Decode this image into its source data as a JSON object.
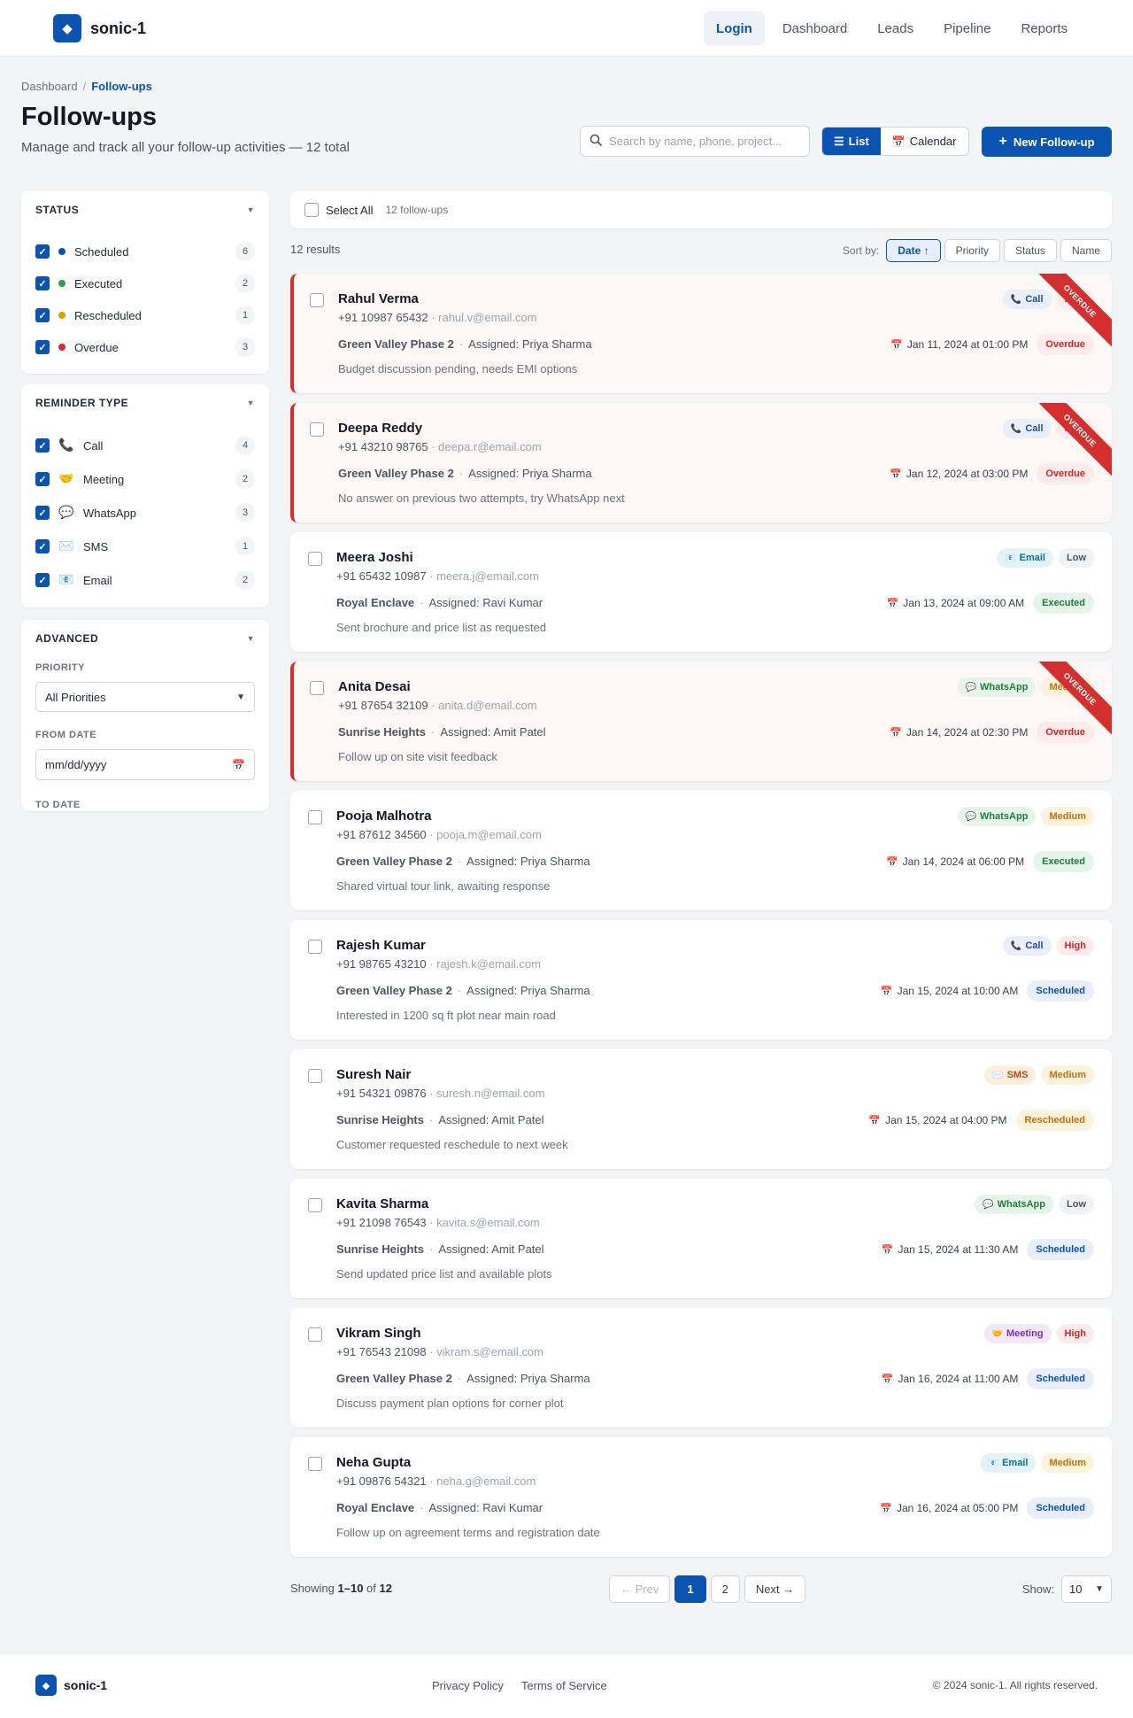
{
  "app": {
    "name": "sonic-1",
    "logo_glyph": "◆"
  },
  "nav": {
    "items": [
      "Login",
      "Dashboard",
      "Leads",
      "Pipeline",
      "Reports"
    ],
    "active": "Login"
  },
  "breadcrumb": {
    "parent": "Dashboard",
    "separator": "/",
    "current": "Follow-ups"
  },
  "page": {
    "title": "Follow-ups",
    "subtitle": "Manage and track all your follow-up activities — 12 total"
  },
  "search": {
    "placeholder": "Search by name, phone, project...",
    "value": ""
  },
  "view_toggle": {
    "list_label": "List",
    "calendar_label": "Calendar",
    "active": "List"
  },
  "new_button": {
    "label": "New Follow-up"
  },
  "filters": {
    "status": {
      "title": "STATUS",
      "items": [
        {
          "label": "Scheduled",
          "count": "6",
          "color": "#0b53b0",
          "checked": true
        },
        {
          "label": "Executed",
          "count": "2",
          "color": "#2e9d4c",
          "checked": true
        },
        {
          "label": "Rescheduled",
          "count": "1",
          "color": "#e0a000",
          "checked": true
        },
        {
          "label": "Overdue",
          "count": "3",
          "color": "#d32f2f",
          "checked": true
        }
      ]
    },
    "reminder_type": {
      "title": "REMINDER TYPE",
      "items": [
        {
          "label": "Call",
          "count": "4",
          "icon": "📞",
          "checked": true
        },
        {
          "label": "Meeting",
          "count": "2",
          "icon": "🤝",
          "checked": true
        },
        {
          "label": "WhatsApp",
          "count": "3",
          "icon": "💬",
          "checked": true
        },
        {
          "label": "SMS",
          "count": "1",
          "icon": "✉️",
          "checked": true
        },
        {
          "label": "Email",
          "count": "2",
          "icon": "📧",
          "checked": true
        }
      ]
    },
    "advanced": {
      "title": "ADVANCED",
      "priority_label": "PRIORITY",
      "priority_value": "All Priorities",
      "from_label": "FROM DATE",
      "from_placeholder": "mm/dd/yyyy",
      "to_label": "TO DATE"
    }
  },
  "selection": {
    "select_all_label": "Select All",
    "count_label": "12 follow-ups"
  },
  "results_label": "12 results",
  "sort": {
    "label": "Sort by:",
    "options": [
      "Date ↑",
      "Priority",
      "Status",
      "Name"
    ],
    "active": "Date ↑"
  },
  "followups": [
    {
      "name": "Rahul Verma",
      "phone": "+91 10987 65432",
      "email": "rahul.v@email.com",
      "project": "Green Valley Phase 2",
      "assigned": "Assigned: Priya Sharma",
      "note": "Budget discussion pending, needs EMI options",
      "datetime": "Jan 11, 2024 at 01:00 PM",
      "channel": "Call",
      "channel_icon": "📞",
      "channel_class": "call",
      "priority": "High",
      "priority_class": "high",
      "status": "Overdue",
      "status_class": "overdue",
      "ribbon": "OVERDUE"
    },
    {
      "name": "Deepa Reddy",
      "phone": "+91 43210 98765",
      "email": "deepa.r@email.com",
      "project": "Green Valley Phase 2",
      "assigned": "Assigned: Priya Sharma",
      "note": "No answer on previous two attempts, try WhatsApp next",
      "datetime": "Jan 12, 2024 at 03:00 PM",
      "channel": "Call",
      "channel_icon": "📞",
      "channel_class": "call",
      "priority": "High",
      "priority_class": "high",
      "status": "Overdue",
      "status_class": "overdue",
      "ribbon": "OVERDUE"
    },
    {
      "name": "Meera Joshi",
      "phone": "+91 65432 10987",
      "email": "meera.j@email.com",
      "project": "Royal Enclave",
      "assigned": "Assigned: Ravi Kumar",
      "note": "Sent brochure and price list as requested",
      "datetime": "Jan 13, 2024 at 09:00 AM",
      "channel": "Email",
      "channel_icon": "📧",
      "channel_class": "email",
      "priority": "Low",
      "priority_class": "low",
      "status": "Executed",
      "status_class": "executed",
      "ribbon": ""
    },
    {
      "name": "Anita Desai",
      "phone": "+91 87654 32109",
      "email": "anita.d@email.com",
      "project": "Sunrise Heights",
      "assigned": "Assigned: Amit Patel",
      "note": "Follow up on site visit feedback",
      "datetime": "Jan 14, 2024 at 02:30 PM",
      "channel": "WhatsApp",
      "channel_icon": "💬",
      "channel_class": "whatsapp",
      "priority": "Medium",
      "priority_class": "medium",
      "status": "Overdue",
      "status_class": "overdue",
      "ribbon": "OVERDUE"
    },
    {
      "name": "Pooja Malhotra",
      "phone": "+91 87612 34560",
      "email": "pooja.m@email.com",
      "project": "Green Valley Phase 2",
      "assigned": "Assigned: Priya Sharma",
      "note": "Shared virtual tour link, awaiting response",
      "datetime": "Jan 14, 2024 at 06:00 PM",
      "channel": "WhatsApp",
      "channel_icon": "💬",
      "channel_class": "whatsapp",
      "priority": "Medium",
      "priority_class": "medium",
      "status": "Executed",
      "status_class": "executed",
      "ribbon": ""
    },
    {
      "name": "Rajesh Kumar",
      "phone": "+91 98765 43210",
      "email": "rajesh.k@email.com",
      "project": "Green Valley Phase 2",
      "assigned": "Assigned: Priya Sharma",
      "note": "Interested in 1200 sq ft plot near main road",
      "datetime": "Jan 15, 2024 at 10:00 AM",
      "channel": "Call",
      "channel_icon": "📞",
      "channel_class": "call",
      "priority": "High",
      "priority_class": "high",
      "status": "Scheduled",
      "status_class": "scheduled",
      "ribbon": ""
    },
    {
      "name": "Suresh Nair",
      "phone": "+91 54321 09876",
      "email": "suresh.n@email.com",
      "project": "Sunrise Heights",
      "assigned": "Assigned: Amit Patel",
      "note": "Customer requested reschedule to next week",
      "datetime": "Jan 15, 2024 at 04:00 PM",
      "channel": "SMS",
      "channel_icon": "✉️",
      "channel_class": "sms",
      "priority": "Medium",
      "priority_class": "medium",
      "status": "Rescheduled",
      "status_class": "rescheduled",
      "ribbon": ""
    },
    {
      "name": "Kavita Sharma",
      "phone": "+91 21098 76543",
      "email": "kavita.s@email.com",
      "project": "Sunrise Heights",
      "assigned": "Assigned: Amit Patel",
      "note": "Send updated price list and available plots",
      "datetime": "Jan 15, 2024 at 11:30 AM",
      "channel": "WhatsApp",
      "channel_icon": "💬",
      "channel_class": "whatsapp",
      "priority": "Low",
      "priority_class": "low",
      "status": "Scheduled",
      "status_class": "scheduled",
      "ribbon": ""
    },
    {
      "name": "Vikram Singh",
      "phone": "+91 76543 21098",
      "email": "vikram.s@email.com",
      "project": "Green Valley Phase 2",
      "assigned": "Assigned: Priya Sharma",
      "note": "Discuss payment plan options for corner plot",
      "datetime": "Jan 16, 2024 at 11:00 AM",
      "channel": "Meeting",
      "channel_icon": "🤝",
      "channel_class": "meeting",
      "priority": "High",
      "priority_class": "high",
      "status": "Scheduled",
      "status_class": "scheduled",
      "ribbon": ""
    },
    {
      "name": "Neha Gupta",
      "phone": "+91 09876 54321",
      "email": "neha.g@email.com",
      "project": "Royal Enclave",
      "assigned": "Assigned: Ravi Kumar",
      "note": "Follow up on agreement terms and registration date",
      "datetime": "Jan 16, 2024 at 05:00 PM",
      "channel": "Email",
      "channel_icon": "📧",
      "channel_class": "email",
      "priority": "Medium",
      "priority_class": "medium",
      "status": "Scheduled",
      "status_class": "scheduled",
      "ribbon": ""
    }
  ],
  "pagination": {
    "showing_prefix": "Showing",
    "range": "1–10",
    "of": "of",
    "total": "12",
    "prev_label": "← Prev",
    "pages": [
      "1",
      "2"
    ],
    "active_page": "1",
    "next_label": "Next →",
    "show_label": "Show:",
    "page_size": "10"
  },
  "footer": {
    "brand": "sonic-1",
    "links": [
      "Privacy Policy",
      "Terms of Service"
    ],
    "copyright": "© 2024 sonic-1. All rights reserved."
  }
}
